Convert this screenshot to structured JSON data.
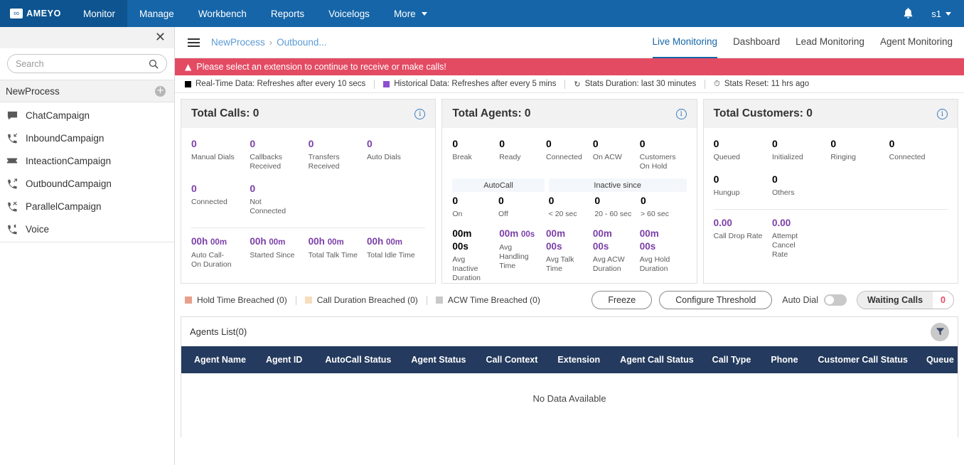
{
  "topnav": {
    "brand": "AMEYO",
    "items": [
      {
        "label": "Monitor",
        "active": true
      },
      {
        "label": "Manage",
        "active": false
      },
      {
        "label": "Workbench",
        "active": false
      },
      {
        "label": "Reports",
        "active": false
      },
      {
        "label": "Voicelogs",
        "active": false
      },
      {
        "label": "More",
        "active": false,
        "caret": true
      }
    ],
    "notification_icon": "bell-icon",
    "user": "s1"
  },
  "sidebar": {
    "close_icon": "close-icon",
    "search": {
      "value": "",
      "placeholder": "Search",
      "icon": "search-icon"
    },
    "process": {
      "name": "NewProcess",
      "add_icon": "add-circle-icon"
    },
    "items": [
      {
        "label": "ChatCampaign",
        "icon": "chat-icon"
      },
      {
        "label": "InboundCampaign",
        "icon": "phone-incoming-icon"
      },
      {
        "label": "InteactionCampaign",
        "icon": "ticket-icon"
      },
      {
        "label": "OutboundCampaign",
        "icon": "phone-outgoing-icon"
      },
      {
        "label": "ParallelCampaign",
        "icon": "phone-parallel-icon"
      },
      {
        "label": "Voice",
        "icon": "phone-speaker-icon"
      }
    ]
  },
  "breadcrumb": {
    "menu_icon": "hamburger-icon",
    "root": "NewProcess",
    "separator": "›",
    "current": "Outbound..."
  },
  "tabs": [
    {
      "label": "Live Monitoring",
      "active": true
    },
    {
      "label": "Dashboard",
      "active": false
    },
    {
      "label": "Lead Monitoring",
      "active": false
    },
    {
      "label": "Agent Monitoring",
      "active": false
    }
  ],
  "alert": {
    "icon": "warning-icon",
    "text": "Please select an extension to continue to receive or make calls!",
    "color": "#e34b63"
  },
  "stats_bar": {
    "realtime": {
      "swatch": "#000000",
      "text": "Real-Time Data: Refreshes after every 10 secs"
    },
    "historical": {
      "swatch": "#8e4fd0",
      "text": "Historical Data: Refreshes after every 5 mins"
    },
    "duration": {
      "icon": "refresh-icon",
      "text": "Stats Duration: last 30 minutes"
    },
    "reset": {
      "icon": "clock-icon",
      "text": "Stats Reset: 11 hrs ago"
    }
  },
  "cards": {
    "total_calls": {
      "title": "Total Calls: 0",
      "info_icon": "info-icon",
      "row1": [
        {
          "value": "0",
          "label": "Manual Dials",
          "purple": true
        },
        {
          "value": "0",
          "label": "Callbacks Received",
          "purple": true
        },
        {
          "value": "0",
          "label": "Transfers Received",
          "purple": true
        },
        {
          "value": "0",
          "label": "Auto Dials",
          "purple": true
        }
      ],
      "row2": [
        {
          "value": "0",
          "label": "Connected",
          "purple": true
        },
        {
          "value": "0",
          "label": "Not Connected",
          "purple": true
        }
      ],
      "row3": [
        {
          "value": "00h",
          "unit": "00m",
          "label": "Auto Call-On Duration"
        },
        {
          "value": "00h",
          "unit": "00m",
          "label": "Started Since"
        },
        {
          "value": "00h",
          "unit": "00m",
          "label": "Total Talk Time"
        },
        {
          "value": "00h",
          "unit": "00m",
          "label": "Total Idle Time"
        }
      ]
    },
    "total_agents": {
      "title": "Total Agents: 0",
      "info_icon": "info-icon",
      "row1": [
        {
          "value": "0",
          "label": "Break"
        },
        {
          "value": "0",
          "label": "Ready"
        },
        {
          "value": "0",
          "label": "Connected"
        },
        {
          "value": "0",
          "label": "On ACW"
        },
        {
          "value": "0",
          "label": "Customers On Hold"
        }
      ],
      "band_autocall": {
        "title": "AutoCall",
        "metrics": [
          {
            "value": "0",
            "label": "On"
          },
          {
            "value": "0",
            "label": "Off"
          }
        ]
      },
      "band_inactive": {
        "title": "Inactive since",
        "metrics": [
          {
            "value": "0",
            "label": "< 20 sec"
          },
          {
            "value": "0",
            "label": "20 - 60 sec"
          },
          {
            "value": "0",
            "label": "> 60 sec"
          }
        ]
      },
      "row3": [
        {
          "value": "00m",
          "unit": "00s",
          "label": "Avg Inactive Duration",
          "black": true
        },
        {
          "value": "00m",
          "unit": "00s",
          "label": "Avg Handling Time",
          "black": false
        },
        {
          "value": "00m",
          "unit": "00s",
          "label": "Avg Talk Time",
          "black": false
        },
        {
          "value": "00m",
          "unit": "00s",
          "label": "Avg ACW Duration",
          "black": false
        },
        {
          "value": "00m",
          "unit": "00s",
          "label": "Avg Hold Duration",
          "black": false
        }
      ]
    },
    "total_customers": {
      "title": "Total Customers: 0",
      "info_icon": "info-icon",
      "row1": [
        {
          "value": "0",
          "label": "Queued"
        },
        {
          "value": "0",
          "label": "Initialized"
        },
        {
          "value": "0",
          "label": "Ringing"
        },
        {
          "value": "0",
          "label": "Connected"
        }
      ],
      "row2": [
        {
          "value": "0",
          "label": "Hungup"
        },
        {
          "value": "0",
          "label": "Others"
        }
      ],
      "row3": [
        {
          "value": "0.00",
          "label": "Call Drop Rate"
        },
        {
          "value": "0.00",
          "label": "Attempt Cancel Rate"
        }
      ]
    }
  },
  "breach_bar": {
    "items": [
      {
        "label": "Hold Time Breached (0)",
        "color": "#e8a08a",
        "cls": "peach"
      },
      {
        "label": "Call Duration Breached (0)",
        "color": "#f6ddbd",
        "cls": "cream"
      },
      {
        "label": "ACW Time Breached (0)",
        "color": "#c9c9c9",
        "cls": "gray"
      }
    ],
    "freeze_label": "Freeze",
    "configure_label": "Configure Threshold",
    "auto_dial_label": "Auto Dial",
    "auto_dial_on": false,
    "waiting_calls_label": "Waiting Calls",
    "waiting_calls_count": "0"
  },
  "agents_list": {
    "title": "Agents List(0)",
    "filter_icon": "filter-icon",
    "columns": [
      "Agent Name",
      "Agent ID",
      "AutoCall Status",
      "Agent Status",
      "Call Context",
      "Extension",
      "Agent Call Status",
      "Call Type",
      "Phone",
      "Customer Call Status",
      "Queue"
    ],
    "empty_text": "No Data Available"
  }
}
